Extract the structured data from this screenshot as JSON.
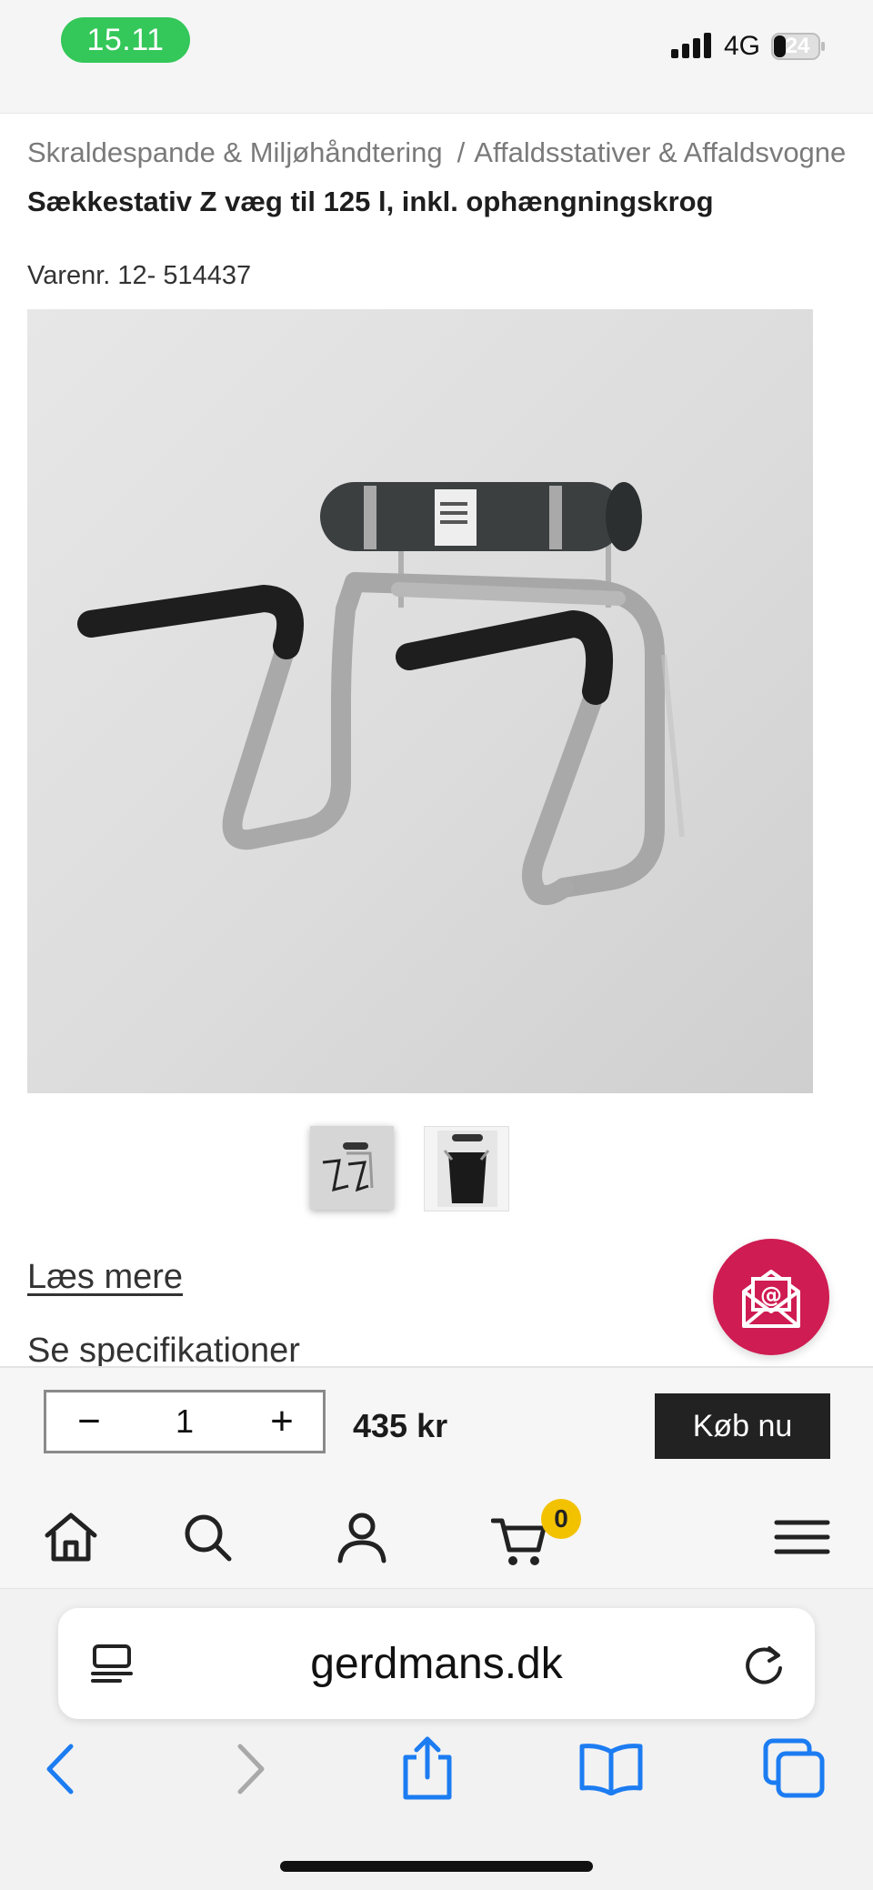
{
  "status_bar": {
    "time": "15.11",
    "network": "4G",
    "battery": "24"
  },
  "breadcrumb": {
    "items": [
      "Skraldespande & Miljøhåndtering",
      "Affaldsstativer & Affaldsvogne"
    ],
    "separator": "/"
  },
  "product": {
    "title": "Sækkestativ Z væg til 125 l, inkl. ophængningskrog",
    "sku_label": "Varenr. 12- 514437"
  },
  "links": {
    "read_more": "Læs mere",
    "specifications": "Se specifikationer"
  },
  "buy_bar": {
    "minus": "−",
    "quantity": "1",
    "plus": "+",
    "price": "435 kr",
    "buy_label": "Køb nu"
  },
  "bottom_nav": {
    "cart_count": "0"
  },
  "browser": {
    "url": "gerdmans.dk"
  },
  "colors": {
    "accent_newsletter": "#cf1c52",
    "badge": "#f2c200",
    "ios_blue": "#1c7cf2",
    "status_green": "#34c759"
  },
  "icons": [
    "home-icon",
    "search-icon",
    "account-icon",
    "cart-icon",
    "menu-icon",
    "reader-icon",
    "reload-icon",
    "back-icon",
    "forward-icon",
    "share-icon",
    "bookmarks-icon",
    "tabs-icon",
    "mail-icon"
  ]
}
